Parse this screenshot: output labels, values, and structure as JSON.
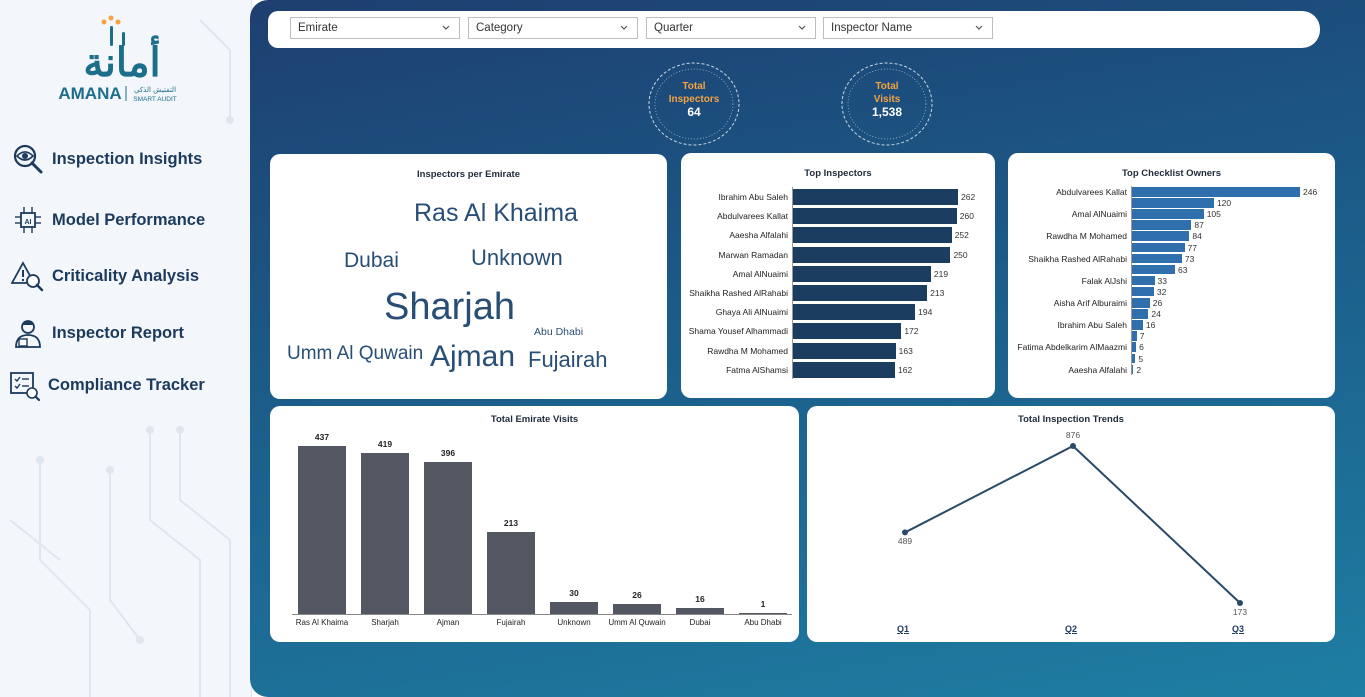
{
  "brand": {
    "name_ar": "أمانة",
    "name_en": "AMANA",
    "subtitle_ar": "التفتيش الذكي",
    "subtitle_en": "SMART AUDIT",
    "colors": {
      "teal": "#1d6e8a",
      "orange": "#f5a340",
      "navy": "#1c3a5c"
    }
  },
  "sidebar": {
    "items": [
      {
        "label": "Inspection Insights",
        "icon": "eye-magnifier-icon"
      },
      {
        "label": "Model Performance",
        "icon": "ai-chip-icon"
      },
      {
        "label": "Criticality Analysis",
        "icon": "warning-magnifier-icon"
      },
      {
        "label": "Inspector Report",
        "icon": "inspector-icon"
      },
      {
        "label": "Compliance Tracker",
        "icon": "checklist-monitor-icon"
      }
    ]
  },
  "filters": [
    {
      "label": "Emirate"
    },
    {
      "label": "Category"
    },
    {
      "label": "Quarter"
    },
    {
      "label": "Inspector Name"
    }
  ],
  "kpis": [
    {
      "label_1": "Total",
      "label_2": "Inspectors",
      "value": "64"
    },
    {
      "label_1": "Total",
      "label_2": "Visits",
      "value": "1,538"
    }
  ],
  "cards": {
    "wordcloud_title": "Inspectors per Emirate",
    "top_inspectors_title": "Top Inspectors",
    "top_owners_title": "Top Checklist Owners",
    "emirate_visits_title": "Total Emirate Visits",
    "trends_title": "Total Inspection Trends"
  },
  "wordcloud": [
    {
      "text": "Ras Al Khaima"
    },
    {
      "text": "Dubai"
    },
    {
      "text": "Unknown"
    },
    {
      "text": "Sharjah"
    },
    {
      "text": "Abu Dhabi"
    },
    {
      "text": "Umm Al Quwain"
    },
    {
      "text": "Ajman"
    },
    {
      "text": "Fujairah"
    }
  ],
  "chart_data": [
    {
      "type": "bar",
      "orientation": "horizontal",
      "title": "Top Inspectors",
      "categories": [
        "Ibrahim Abu Saleh",
        "Abdulvarees Kallat",
        "Aaesha Alfalahi",
        "Marwan Ramadan",
        "Amal AlNuaimi",
        "Shaikha Rashed AlRahabi",
        "Ghaya Ali AlNuaimi",
        "Shama Yousef Alhammadi",
        "Rawdha M Mohamed",
        "Fatma AlShamsi"
      ],
      "values": [
        262,
        260,
        252,
        250,
        219,
        213,
        194,
        172,
        163,
        162
      ],
      "color": "#1b3d5f"
    },
    {
      "type": "bar",
      "orientation": "horizontal",
      "title": "Top Checklist Owners",
      "labeled_categories": [
        "Abdulvarees Kallat",
        "",
        "Amal AlNuaimi",
        "",
        "Rawdha M Mohamed",
        "",
        "Shaikha Rashed AlRahabi",
        "",
        "Falak AlJshi",
        "",
        "Aisha Arif Alburaimi",
        "",
        "Ibrahim Abu Saleh",
        "",
        "Fatima Abdelkarim AlMaazmi",
        "",
        "Aaesha Alfalahi"
      ],
      "values": [
        246,
        120,
        105,
        87,
        84,
        77,
        73,
        63,
        33,
        32,
        26,
        24,
        16,
        7,
        6,
        5,
        2
      ],
      "color": "#2f6fae"
    },
    {
      "type": "bar",
      "title": "Total Emirate Visits",
      "categories": [
        "Ras Al Khaima",
        "Sharjah",
        "Ajman",
        "Fujairah",
        "Unknown",
        "Umm Al Quwain",
        "Dubai",
        "Abu Dhabi"
      ],
      "values": [
        437,
        419,
        396,
        213,
        30,
        26,
        16,
        1
      ],
      "color": "#525762"
    },
    {
      "type": "line",
      "title": "Total Inspection Trends",
      "categories": [
        "Q1",
        "Q2",
        "Q3"
      ],
      "values": [
        489,
        876,
        173
      ],
      "color": "#2a4a68"
    }
  ]
}
